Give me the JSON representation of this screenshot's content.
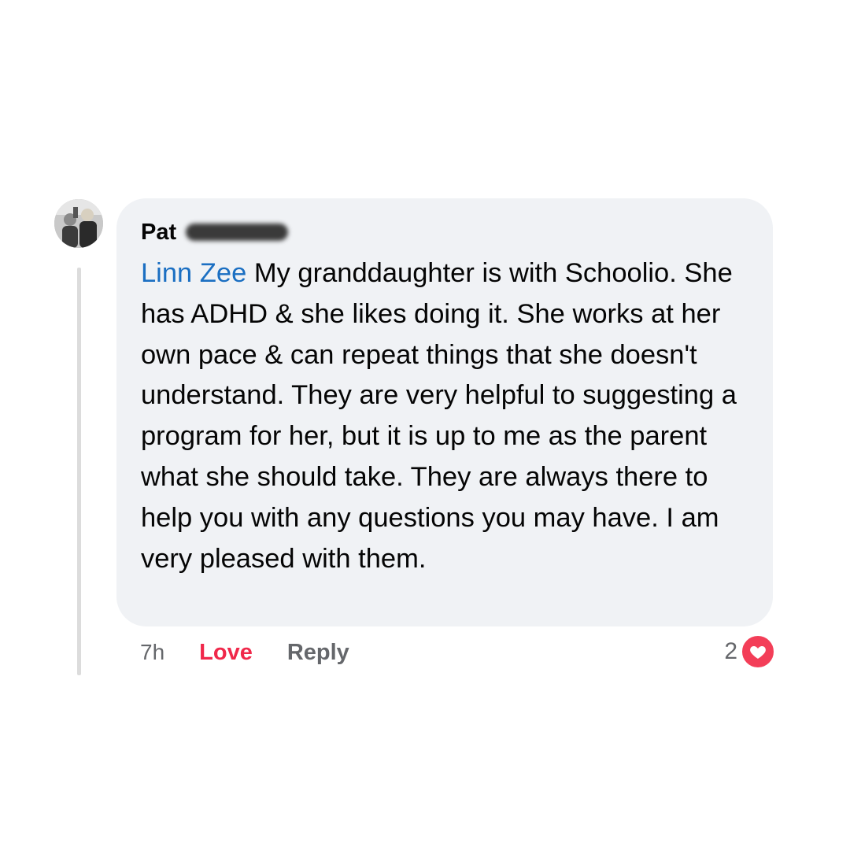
{
  "comment": {
    "author": "Pat",
    "mention": "Linn Zee",
    "body": " My granddaughter is with Schoolio.  She has ADHD & she likes doing it.  She works at her own pace & can repeat things that she doesn't understand. They are very helpful to suggesting a program for her, but it is up to me as the parent what she should take.  They are always there to help you with any questions you may have. I am very pleased with them.",
    "time": "7h",
    "love_label": "Love",
    "reply_label": "Reply",
    "reaction_count": "2",
    "reaction_icon": "heart-icon"
  },
  "colors": {
    "bubble_background": "#f0f2f5",
    "mention": "#1b6fc2",
    "love": "#f0284a",
    "reaction_heart": "#f33e58",
    "secondary_text": "#65676b"
  }
}
